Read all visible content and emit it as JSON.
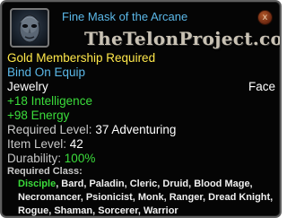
{
  "item": {
    "name": "Fine Mask of the Arcane",
    "membership": "Gold Membership Required",
    "binding": "Bind On Equip",
    "type": "Jewelry",
    "slot": "Face",
    "stats": [
      "+18 Intelligence",
      "+98 Energy"
    ],
    "required_level_label": "Required Level:",
    "required_level_value": "37 Adventuring",
    "item_level_label": "Item Level:",
    "item_level_value": "42",
    "durability_label": "Durability:",
    "durability_value": "100%",
    "required_class_label": "Required Class:",
    "highlighted_class": "Disciple",
    "other_classes": ", Bard, Paladin, Cleric, Druid, Blood Mage, Necromancer, Psionicist, Monk, Ranger, Dread Knight, Rogue, Shaman, Sorcerer, Warrior"
  },
  "watermark": "TheTelonProject.com",
  "close_glyph": "x",
  "icon": "mask-icon",
  "colors": {
    "title": "#5bb8e8",
    "gold": "#ffe84a",
    "bind": "#5bb8e8",
    "label": "#c8c8c8",
    "value": "#ffffff",
    "stat": "#3bdd3b",
    "highlight_class": "#3bdd3b",
    "border": "#5f5f5f"
  }
}
